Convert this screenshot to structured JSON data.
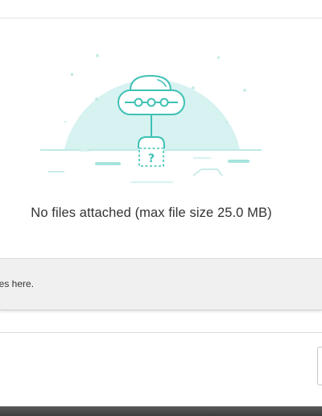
{
  "attachments": {
    "empty_message": "No files attached (max file size 25.0 MB)",
    "drop_zone_text": "files here.",
    "illustration_icon": "ufo-empty-state-icon"
  },
  "colors": {
    "illustration_circle": "#d6f2f1",
    "illustration_stroke": "#3fc1b5",
    "divider": "#e4e4e4",
    "drop_zone_bg": "#f0f0f1",
    "footer_bar": "#454545"
  }
}
